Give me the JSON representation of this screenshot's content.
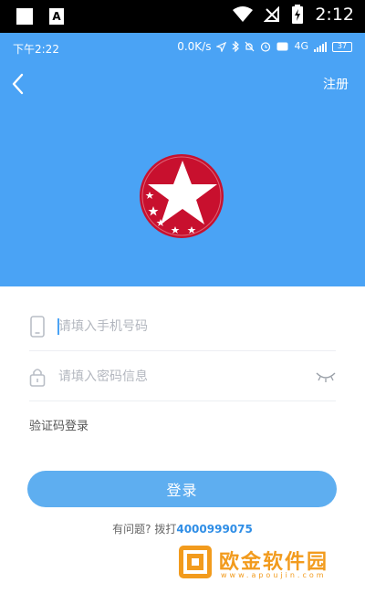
{
  "outer_status": {
    "time": "2:12",
    "icons": [
      "notification-square-icon",
      "a-box-icon",
      "wifi-icon",
      "no-signal-icon",
      "battery-charging-icon"
    ]
  },
  "inner_status": {
    "time": "下午2:22",
    "speed": "0.0K/s",
    "network": "4G",
    "battery": "37",
    "icons": [
      "location-icon",
      "bluetooth-icon",
      "mute-icon",
      "alarm-icon",
      "hd-icon",
      "signal-icon"
    ]
  },
  "header": {
    "back_icon": "chevron-left-icon",
    "register_label": "注册",
    "logo": "red-star-logo",
    "colors": {
      "background": "#4aa3f5"
    }
  },
  "form": {
    "phone": {
      "placeholder": "请填入手机号码",
      "value": "",
      "icon": "phone-icon"
    },
    "password": {
      "placeholder": "请填入密码信息",
      "value": "",
      "icon": "lock-icon",
      "toggle_icon": "eye-closed-icon"
    },
    "sms_login_label": "验证码登录",
    "login_button": "登录",
    "help_prefix": "有问题? 拨打",
    "help_phone": "4000999075"
  },
  "watermark": {
    "text": "欧金软件园",
    "subtext": "www.apoujin.com"
  }
}
